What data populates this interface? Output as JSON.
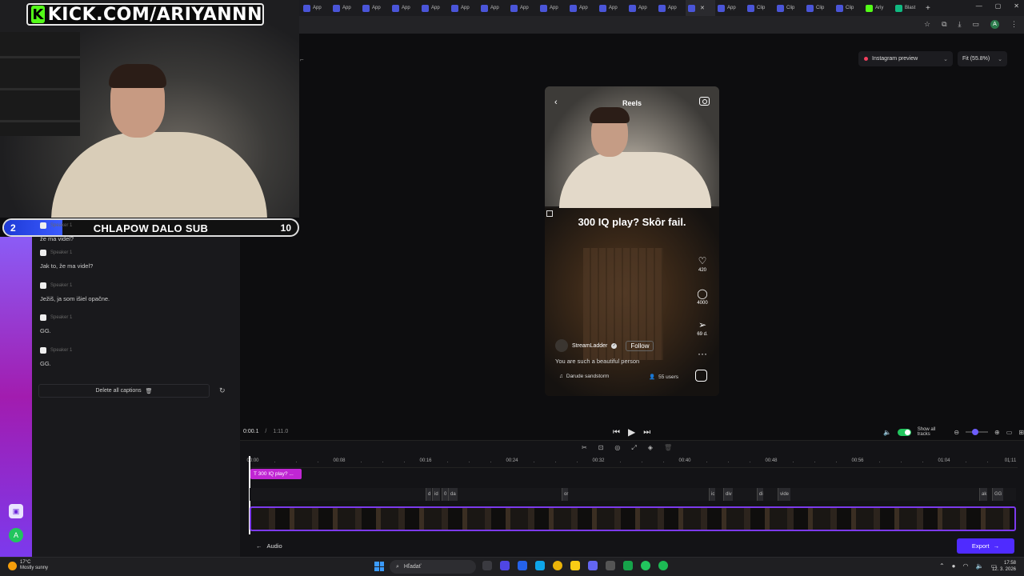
{
  "stream_overlay": {
    "channel": "KICK.COM/ARIYANNN",
    "subgoal": {
      "current": "2",
      "title": "CHLAPOW DALO SUB",
      "target": "10",
      "progress_fraction": 0.2
    }
  },
  "browser": {
    "tabs": [
      {
        "label": "App"
      },
      {
        "label": "App"
      },
      {
        "label": "App"
      },
      {
        "label": "App"
      },
      {
        "label": "App"
      },
      {
        "label": "App"
      },
      {
        "label": "App"
      },
      {
        "label": "App"
      },
      {
        "label": "App"
      },
      {
        "label": "App"
      },
      {
        "label": "App"
      },
      {
        "label": "App"
      },
      {
        "label": "App"
      },
      {
        "label": "",
        "active": true
      },
      {
        "label": "App"
      },
      {
        "label": "Clip"
      },
      {
        "label": "Clip"
      },
      {
        "label": "Clip"
      },
      {
        "label": "Clip"
      },
      {
        "label": "Ariy"
      },
      {
        "label": "Blast"
      }
    ],
    "profile_initial": "A"
  },
  "captions": {
    "items": [
      {
        "speaker": "Speaker 1",
        "text": "že ma videl?"
      },
      {
        "speaker": "Speaker 1",
        "text": "Jak to, že ma videl?"
      },
      {
        "speaker": "Speaker 1",
        "text": "Ježiš, ja som išiel opačne."
      },
      {
        "speaker": "Speaker 1",
        "text": "GG."
      },
      {
        "speaker": "Speaker 1",
        "text": "GG."
      }
    ],
    "delete_all_label": "Delete all captions"
  },
  "left_rail": {
    "avatar_initial": "A"
  },
  "preview": {
    "platform_label": "Instagram preview",
    "fit_label": "Fit (55.8%)",
    "reels_title": "Reels",
    "caption_text": "300 IQ play? Skôr fail.",
    "likes": "420",
    "comments": "4000",
    "shares": "69 d.",
    "author": "StreamLadder",
    "follow_label": "Follow",
    "description": "You are such a beautiful person",
    "music": "Darude sandstorm",
    "users": "55 users"
  },
  "player": {
    "current_time": "0:00.1",
    "separator": "/",
    "duration": "1:11.0",
    "show_all_tracks_label": "Show all tracks"
  },
  "timeline": {
    "ruler_labels": [
      "00:00",
      "00:08",
      "00:16",
      "00:24",
      "00:32",
      "00:40",
      "00:48",
      "00:56",
      "01:04",
      "01:11"
    ],
    "text_clip_label": "300 IQ play? ...",
    "caption_segments": [
      "d",
      "id",
      "0",
      "da",
      "or",
      "ic",
      "div",
      "di",
      "vide",
      "ak",
      "GG"
    ],
    "audio_label": "Audio",
    "export_label": "Export"
  },
  "taskbar": {
    "weather_temp": "17°C",
    "weather_desc": "Mostly sunny",
    "search_placeholder": "Hľadať",
    "time": "17:58",
    "date": "12. 3. 2026"
  }
}
